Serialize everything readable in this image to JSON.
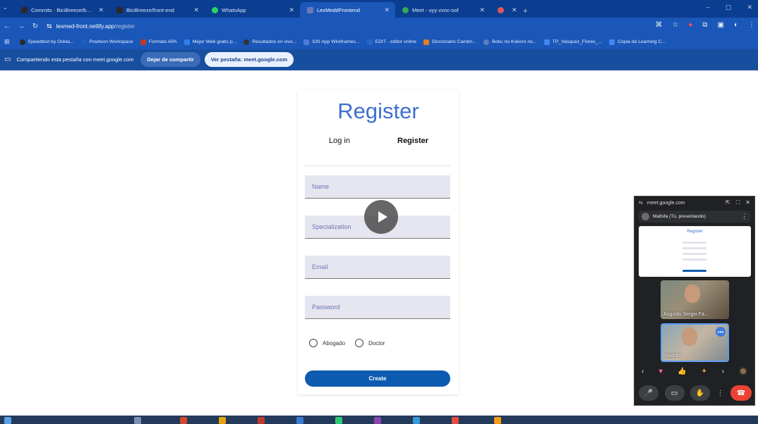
{
  "browser": {
    "tabs": [
      {
        "label": "Commits · BiciBreeze/back-end",
        "icon_color": "#2a2a2a",
        "active": false
      },
      {
        "label": "BiciBreeze/front-end",
        "icon_color": "#2a2a2a",
        "active": false
      },
      {
        "label": "WhatsApp",
        "icon_color": "#25d366",
        "active": false
      },
      {
        "label": "LexMeddFrontend",
        "icon_color": "#6b79b8",
        "active": true
      },
      {
        "label": "Meet - uyy-zvoc-oof",
        "icon_color": "#34a853",
        "active": false
      },
      {
        "label": "",
        "icon_color": "#e05757",
        "active": false
      }
    ],
    "url_host": "lexmed-front.netlify.app",
    "url_path": "/register",
    "bookmarks": [
      {
        "label": "Speedtest by Ookla...",
        "color": "#2c2c2c"
      },
      {
        "label": "Powtoon Workspace",
        "color": "#1d5fbf"
      },
      {
        "label": "Formato APA",
        "color": "#c0392b"
      },
      {
        "label": "Mejor Web gratis p...",
        "color": "#2f80ed"
      },
      {
        "label": "Resultados en vivo...",
        "color": "#333333"
      },
      {
        "label": "iOS App Wireframes...",
        "color": "#4e7bd4"
      },
      {
        "label": "EDIT - editor online",
        "color": "#2a65c9"
      },
      {
        "label": "Diccionario Cambri...",
        "color": "#e67e22"
      },
      {
        "label": "Boku no Kokoro no...",
        "color": "#5b7fc0"
      },
      {
        "label": "TP_Vasquez_Flores_...",
        "color": "#4285f4"
      },
      {
        "label": "Copia de Learning C...",
        "color": "#4285f4"
      }
    ],
    "share_bar": {
      "text": "Compartiendo esta pestaña con meet.google.com",
      "stop_label": "Dejar de compartir",
      "view_label": "Ver pestaña: meet.google.com"
    }
  },
  "register_form": {
    "title": "Register",
    "tab_login": "Log in",
    "tab_register": "Register",
    "fields": {
      "name": "Name",
      "specialization": "Specialization",
      "email": "Email",
      "password": "Password"
    },
    "role_options": [
      "Abogado",
      "Doctor"
    ],
    "submit_label": "Create",
    "accent_color": "#3e6fd1",
    "button_color": "#0d5ab1"
  },
  "meet_pip": {
    "host": "meet.google.com",
    "presenter_label": "Mathifa (Tú, presentando)",
    "participants": [
      {
        "name": "Augusto Sergio Fa..."
      },
      {
        "name": "Mathifa"
      }
    ]
  },
  "colors": {
    "tab_strip": "#0b3d91",
    "toolbar": "#1a57b8",
    "end_call": "#ea4335"
  }
}
